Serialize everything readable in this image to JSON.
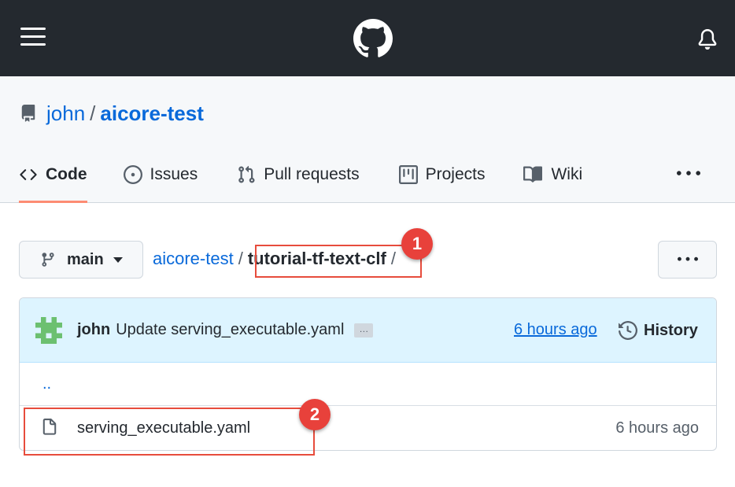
{
  "header": {
    "logo": "github-mark-icon",
    "menu_icon": "hamburger-icon",
    "notifications_icon": "bell-icon"
  },
  "repo": {
    "owner": "john",
    "separator": "/",
    "name": "aicore-test"
  },
  "tabs": [
    {
      "label": "Code",
      "icon": "code-icon",
      "active": true
    },
    {
      "label": "Issues",
      "icon": "issue-icon"
    },
    {
      "label": "Pull requests",
      "icon": "pull-request-icon"
    },
    {
      "label": "Projects",
      "icon": "project-icon"
    },
    {
      "label": "Wiki",
      "icon": "book-icon"
    }
  ],
  "branch": {
    "name": "main"
  },
  "path": {
    "root": "aicore-test",
    "current": "tutorial-tf-text-clf",
    "trailing_slash": "/"
  },
  "annotations": {
    "badge1": "1",
    "badge2": "2",
    "highlight_color": "#e74c3c"
  },
  "commit": {
    "author": "john",
    "message": "Update serving_executable.yaml",
    "ellipsis": "…",
    "time": "6 hours ago",
    "history_label": "History"
  },
  "files": {
    "parent_link": "..",
    "items": [
      {
        "name": "serving_executable.yaml",
        "age": "6 hours ago",
        "icon": "file-icon"
      }
    ]
  },
  "colors": {
    "header_bg": "#24292f",
    "link": "#0969da",
    "tab_underline": "#fd8c73",
    "commit_bg": "#ddf4ff"
  }
}
